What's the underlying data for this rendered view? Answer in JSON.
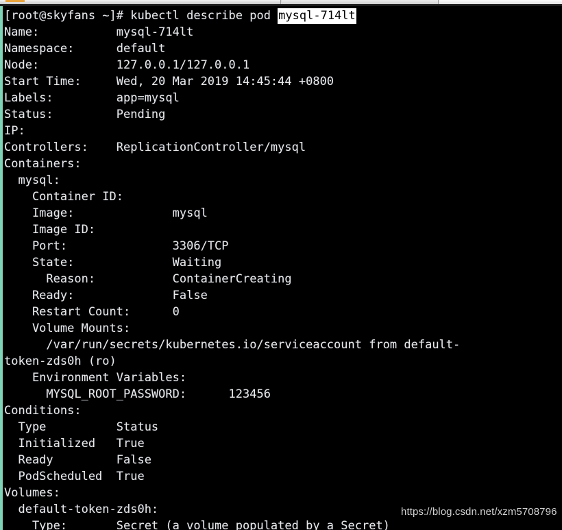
{
  "window": {
    "title": "root@skyfans:~",
    "background_color": "#000000",
    "foreground_color": "#e8e8e8",
    "left_border_color": "#7fd4b8",
    "selection_background": "#ffffff",
    "selection_foreground": "#000000"
  },
  "chrome": {
    "tab_accent_color": "#e8a33d",
    "strip_color": "#d5d5d5"
  },
  "prompt": {
    "text": "[root@skyfans ~]# kubectl describe pod ",
    "selected_argument": "mysql-714lt"
  },
  "terminal_lines": [
    "Name:           mysql-714lt",
    "Namespace:      default",
    "Node:           127.0.0.1/127.0.0.1",
    "Start Time:     Wed, 20 Mar 2019 14:45:44 +0800",
    "Labels:         app=mysql",
    "Status:         Pending",
    "IP:",
    "Controllers:    ReplicationController/mysql",
    "Containers:",
    "  mysql:",
    "    Container ID:",
    "    Image:              mysql",
    "    Image ID:",
    "    Port:               3306/TCP",
    "    State:              Waiting",
    "      Reason:           ContainerCreating",
    "    Ready:              False",
    "    Restart Count:      0",
    "    Volume Mounts:",
    "      /var/run/secrets/kubernetes.io/serviceaccount from default-",
    "token-zds0h (ro)",
    "    Environment Variables:",
    "      MYSQL_ROOT_PASSWORD:      123456",
    "Conditions:",
    "  Type          Status",
    "  Initialized   True",
    "  Ready         False",
    "  PodScheduled  True",
    "Volumes:",
    "  default-token-zds0h:",
    "    Type:       Secret (a volume populated by a Secret)"
  ],
  "describe": {
    "command": "kubectl describe pod mysql-714lt",
    "pod": {
      "name": "mysql-714lt",
      "namespace": "default",
      "node": "127.0.0.1/127.0.0.1",
      "start_time": "Wed, 20 Mar 2019 14:45:44 +0800",
      "labels": "app=mysql",
      "status": "Pending",
      "ip": "",
      "controllers": "ReplicationController/mysql"
    },
    "containers": [
      {
        "name": "mysql",
        "container_id": "",
        "image": "mysql",
        "image_id": "",
        "port": "3306/TCP",
        "state": "Waiting",
        "reason": "ContainerCreating",
        "ready": "False",
        "restart_count": "0",
        "volume_mounts": "/var/run/secrets/kubernetes.io/serviceaccount from default-token-zds0h (ro)",
        "environment_variables": [
          {
            "key": "MYSQL_ROOT_PASSWORD",
            "value": "123456"
          }
        ]
      }
    ],
    "conditions": {
      "headers": [
        "Type",
        "Status"
      ],
      "rows": [
        [
          "Initialized",
          "True"
        ],
        [
          "Ready",
          "False"
        ],
        [
          "PodScheduled",
          "True"
        ]
      ]
    },
    "volumes": [
      {
        "name": "default-token-zds0h",
        "type": "Secret (a volume populated by a Secret)"
      }
    ]
  },
  "watermark": {
    "text": "https://blog.csdn.net/xzm5708796"
  }
}
